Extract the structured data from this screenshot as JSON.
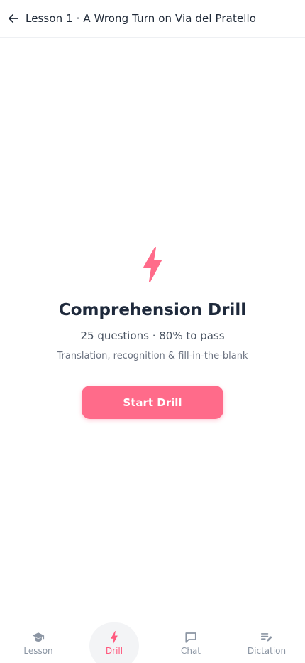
{
  "header": {
    "title": "Lesson 1 · A Wrong Turn on Via del Pratello",
    "back_icon": "arrow-left-icon"
  },
  "drill": {
    "icon": "lightning-bolt-icon",
    "title": "Comprehension Drill",
    "meta": "25 questions · 80% to pass",
    "description": "Translation, recognition & fill-in-the-blank",
    "start_label": "Start Drill"
  },
  "nav": {
    "items": [
      {
        "label": "Lesson",
        "icon": "graduation-cap-icon",
        "active": false
      },
      {
        "label": "Drill",
        "icon": "lightning-bolt-icon",
        "active": true
      },
      {
        "label": "Chat",
        "icon": "chat-bubble-icon",
        "active": false
      },
      {
        "label": "Dictation",
        "icon": "dictation-icon",
        "active": false
      }
    ]
  },
  "colors": {
    "accent": "#ff6b8a",
    "accent_text": "#ff5a7f",
    "inactive": "#8b95a3"
  }
}
